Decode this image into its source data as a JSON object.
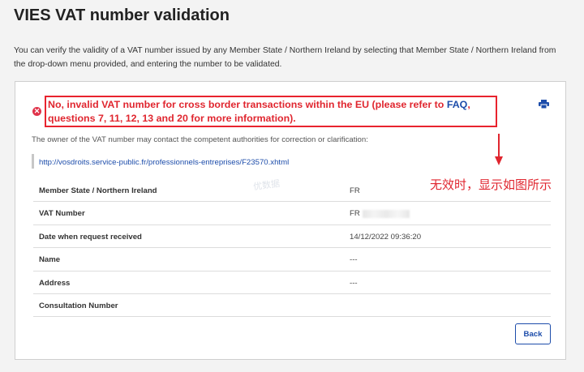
{
  "page": {
    "title": "VIES VAT number validation",
    "intro": "You can verify the validity of a VAT number issued by any Member State / Northern Ireland by selecting that Member State / Northern Ireland from the drop-down menu provided, and entering the number to be validated."
  },
  "result": {
    "error_icon": "error-x-icon",
    "error_prefix": "No, invalid VAT number for cross border transactions within the EU (please refer to ",
    "faq_label": "FAQ",
    "error_suffix": ", questions 7, 11, 12, 13 and 20 for more information).",
    "print_icon": "printer-icon",
    "owner_note": "The owner of the VAT number may contact the competent authorities for correction or clarification:",
    "authority_url": "http://vosdroits.service-public.fr/professionnels-entreprises/F23570.xhtml"
  },
  "details": [
    {
      "label": "Member State / Northern Ireland",
      "value": "FR"
    },
    {
      "label": "VAT Number",
      "value": "FR"
    },
    {
      "label": "Date when request received",
      "value": "14/12/2022 09:36:20"
    },
    {
      "label": "Name",
      "value": "---"
    },
    {
      "label": "Address",
      "value": "---"
    },
    {
      "label": "Consultation Number",
      "value": ""
    }
  ],
  "actions": {
    "back_label": "Back"
  },
  "annotation": {
    "text": "无效时，显示如图所示",
    "watermark": "优数据",
    "color": "#e0262f"
  },
  "colors": {
    "error": "#e0262f",
    "link": "#1c4caa"
  }
}
